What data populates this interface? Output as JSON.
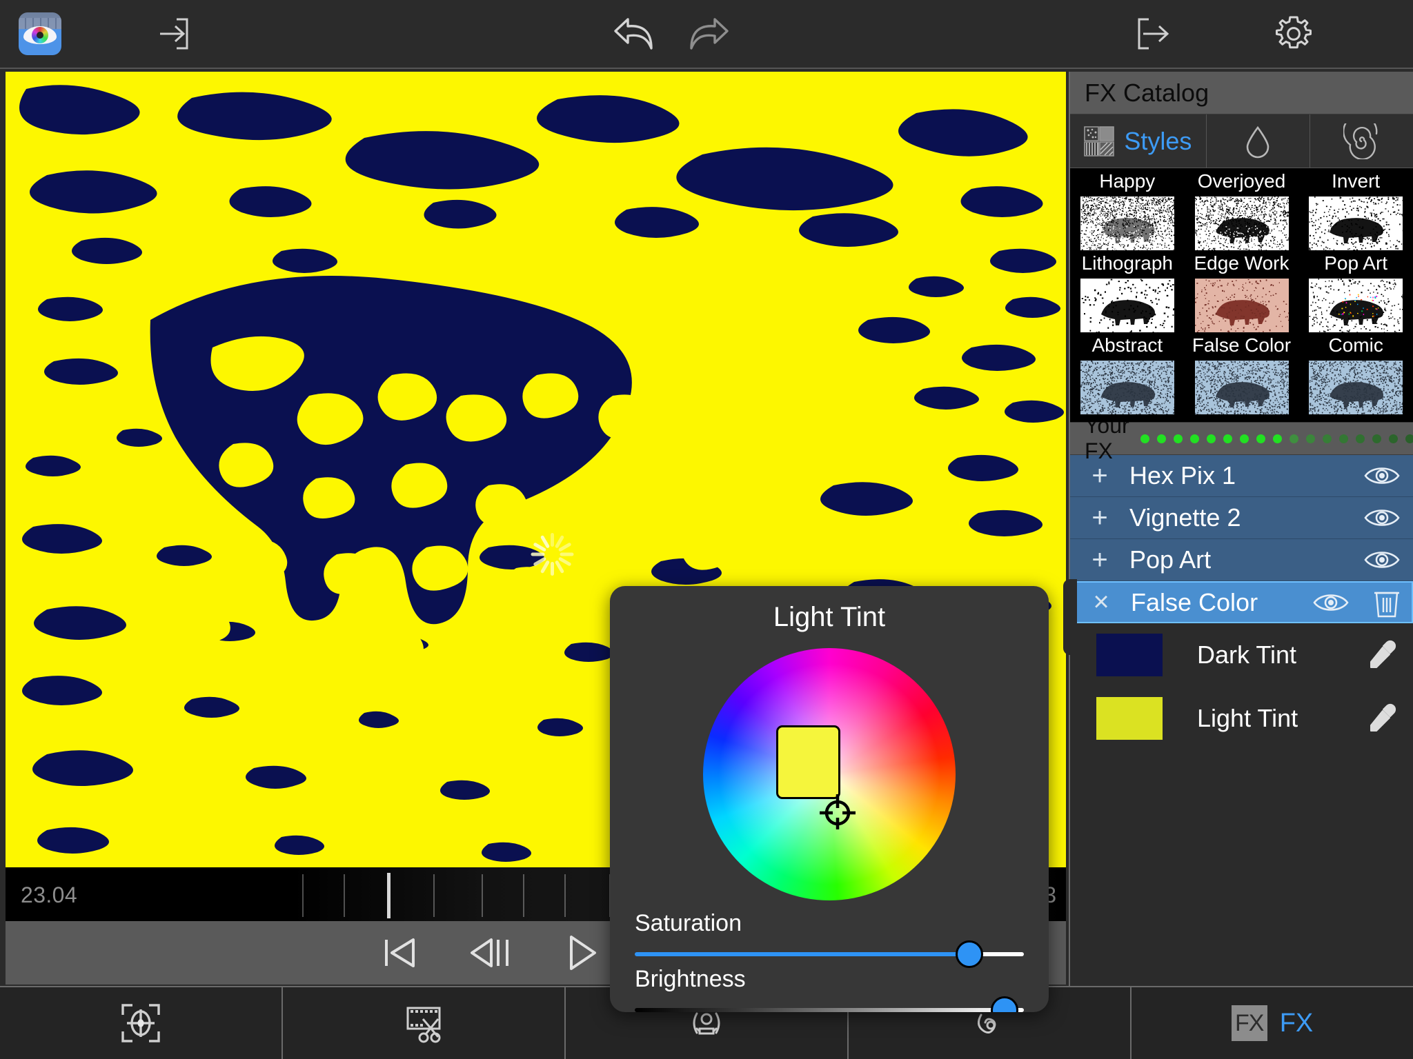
{
  "app": {
    "logo_icon": "eye-color-wheel-app-icon"
  },
  "toolbar": {
    "import_icon": "import-arrow-into-box-icon",
    "undo_icon": "undo-arrow-icon",
    "redo_icon": "redo-arrow-icon",
    "export_icon": "export-arrow-out-of-box-icon",
    "settings_icon": "gear-icon"
  },
  "preview": {
    "spinner_icon": "loading-spinner-icon",
    "light_tint_color": "#fdf700",
    "dark_tint_color": "#0a1050"
  },
  "timeline": {
    "current_time": "23.04",
    "right_time": "3",
    "playhead_position_pct": 36
  },
  "transport": {
    "buttons": [
      {
        "name": "skip-to-start-button",
        "icon": "skip-to-start-icon"
      },
      {
        "name": "step-back-button",
        "icon": "step-backward-icon"
      },
      {
        "name": "play-button",
        "icon": "play-triangle-icon"
      },
      {
        "name": "step-forward-button",
        "icon": "step-forward-icon"
      }
    ]
  },
  "tabbar": {
    "tabs": [
      {
        "name": "tab-focus",
        "icon": "focus-target-icon",
        "label": "",
        "active": false
      },
      {
        "name": "tab-trim",
        "icon": "film-scissors-icon",
        "label": "",
        "active": false
      },
      {
        "name": "tab-face",
        "icon": "face-mask-icon",
        "label": "",
        "active": false
      },
      {
        "name": "tab-audio",
        "icon": "swirl-small-icon",
        "label": "",
        "active": false
      },
      {
        "name": "tab-fx",
        "icon": "fx-badge-icon",
        "label": "FX",
        "active": true
      }
    ]
  },
  "panel": {
    "title": "FX Catalog",
    "catalog_tabs": [
      {
        "name": "tab-styles",
        "label": "Styles",
        "icon": "pattern-swatches-icon",
        "active": true
      },
      {
        "name": "tab-color",
        "label": "",
        "icon": "water-droplet-icon",
        "active": false
      },
      {
        "name": "tab-distort",
        "label": "",
        "icon": "spiral-icon",
        "active": false
      }
    ],
    "styles": {
      "rows": [
        [
          "Happy",
          "Overjoyed",
          "Invert"
        ],
        [
          "Lithograph",
          "Edge Work",
          "Pop Art"
        ],
        [
          "Abstract",
          "False Color",
          "Comic"
        ]
      ]
    },
    "your_fx": {
      "title": "Your FX",
      "perf_dots": [
        "#22e022",
        "#22e022",
        "#22e022",
        "#22e022",
        "#22e022",
        "#22e022",
        "#22e022",
        "#22e022",
        "#22e022",
        "#3f8f3f",
        "#3b863b",
        "#377e37",
        "#347734",
        "#317031",
        "#2e6a2e",
        "#2c652c",
        "#2a602a",
        "#8f8b30",
        "#8f8b30",
        "#a03030"
      ],
      "layers": [
        {
          "name": "Hex Pix 1",
          "toggle": "+",
          "selected": false,
          "has_trash": false
        },
        {
          "name": "Vignette 2",
          "toggle": "+",
          "selected": false,
          "has_trash": false
        },
        {
          "name": "Pop Art",
          "toggle": "+",
          "selected": false,
          "has_trash": false
        },
        {
          "name": "False Color",
          "toggle": "×",
          "selected": true,
          "has_trash": true
        }
      ],
      "tints": [
        {
          "label": "Dark Tint",
          "color": "#0a1050",
          "pick_icon": "eyedropper-icon"
        },
        {
          "label": "Light Tint",
          "color": "#dbe222",
          "pick_icon": "eyedropper-icon"
        }
      ]
    }
  },
  "dialog": {
    "title": "Light Tint",
    "selected_color": "#f5f53c",
    "cursor_icon": "crosshair-target-icon",
    "sliders": [
      {
        "name": "saturation-slider",
        "label": "Saturation",
        "value_pct": 86,
        "track_type": "blue"
      },
      {
        "name": "brightness-slider",
        "label": "Brightness",
        "value_pct": 95,
        "track_type": "gradient"
      }
    ]
  }
}
